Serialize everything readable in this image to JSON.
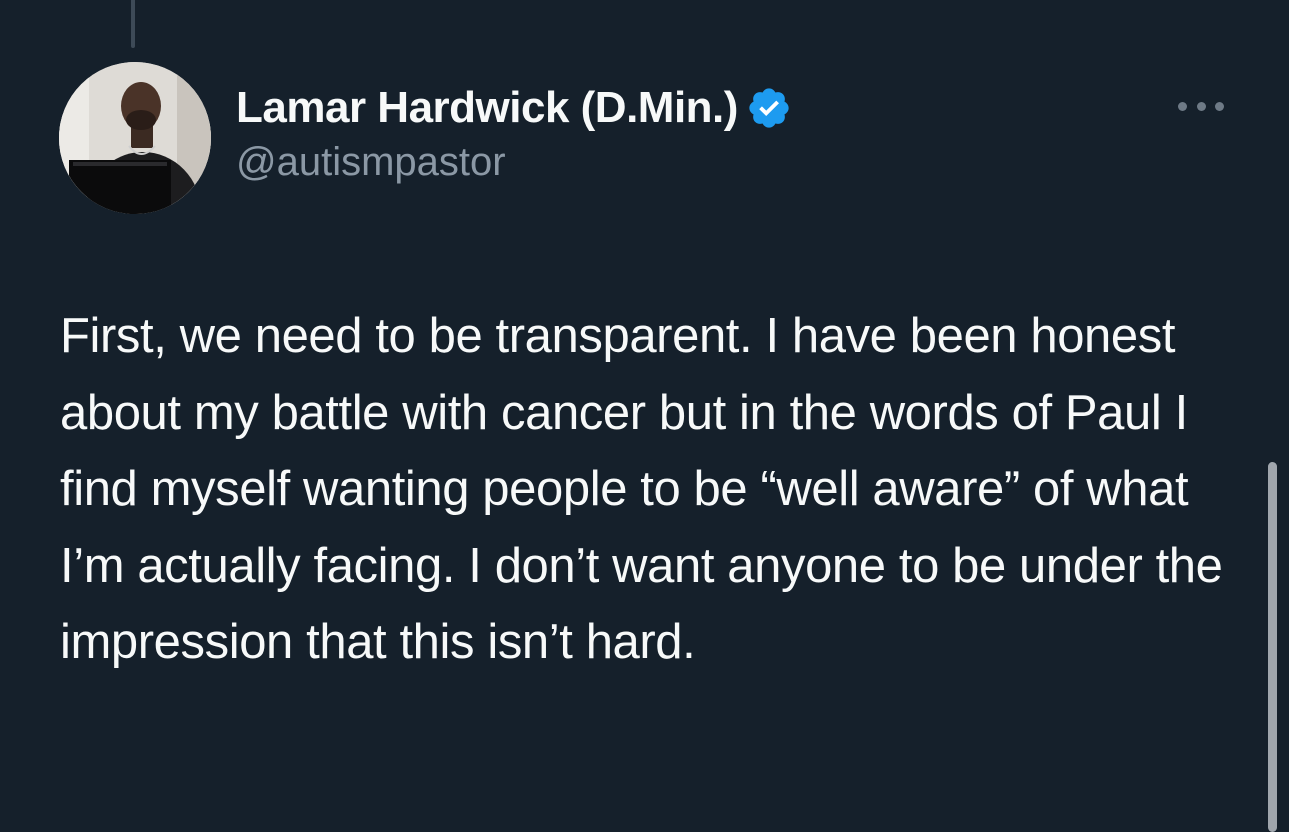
{
  "author": {
    "display_name": "Lamar Hardwick (D.Min.)",
    "handle": "@autismpastor",
    "verified_icon": "verified-badge-icon",
    "avatar": "avatar-photo"
  },
  "menu": {
    "icon": "more-options-icon"
  },
  "tweet": {
    "text": "First, we need to be transparent. I have been honest about my battle with cancer but in the words of Paul I find myself wanting people to be “well aware” of what I’m actually facing. I don’t want anyone to be under the impression that this isn’t hard."
  },
  "colors": {
    "background": "#15202b",
    "text": "#f7f9f9",
    "secondary_text": "#8b98a5",
    "verified_blue": "#1d9bf0"
  }
}
